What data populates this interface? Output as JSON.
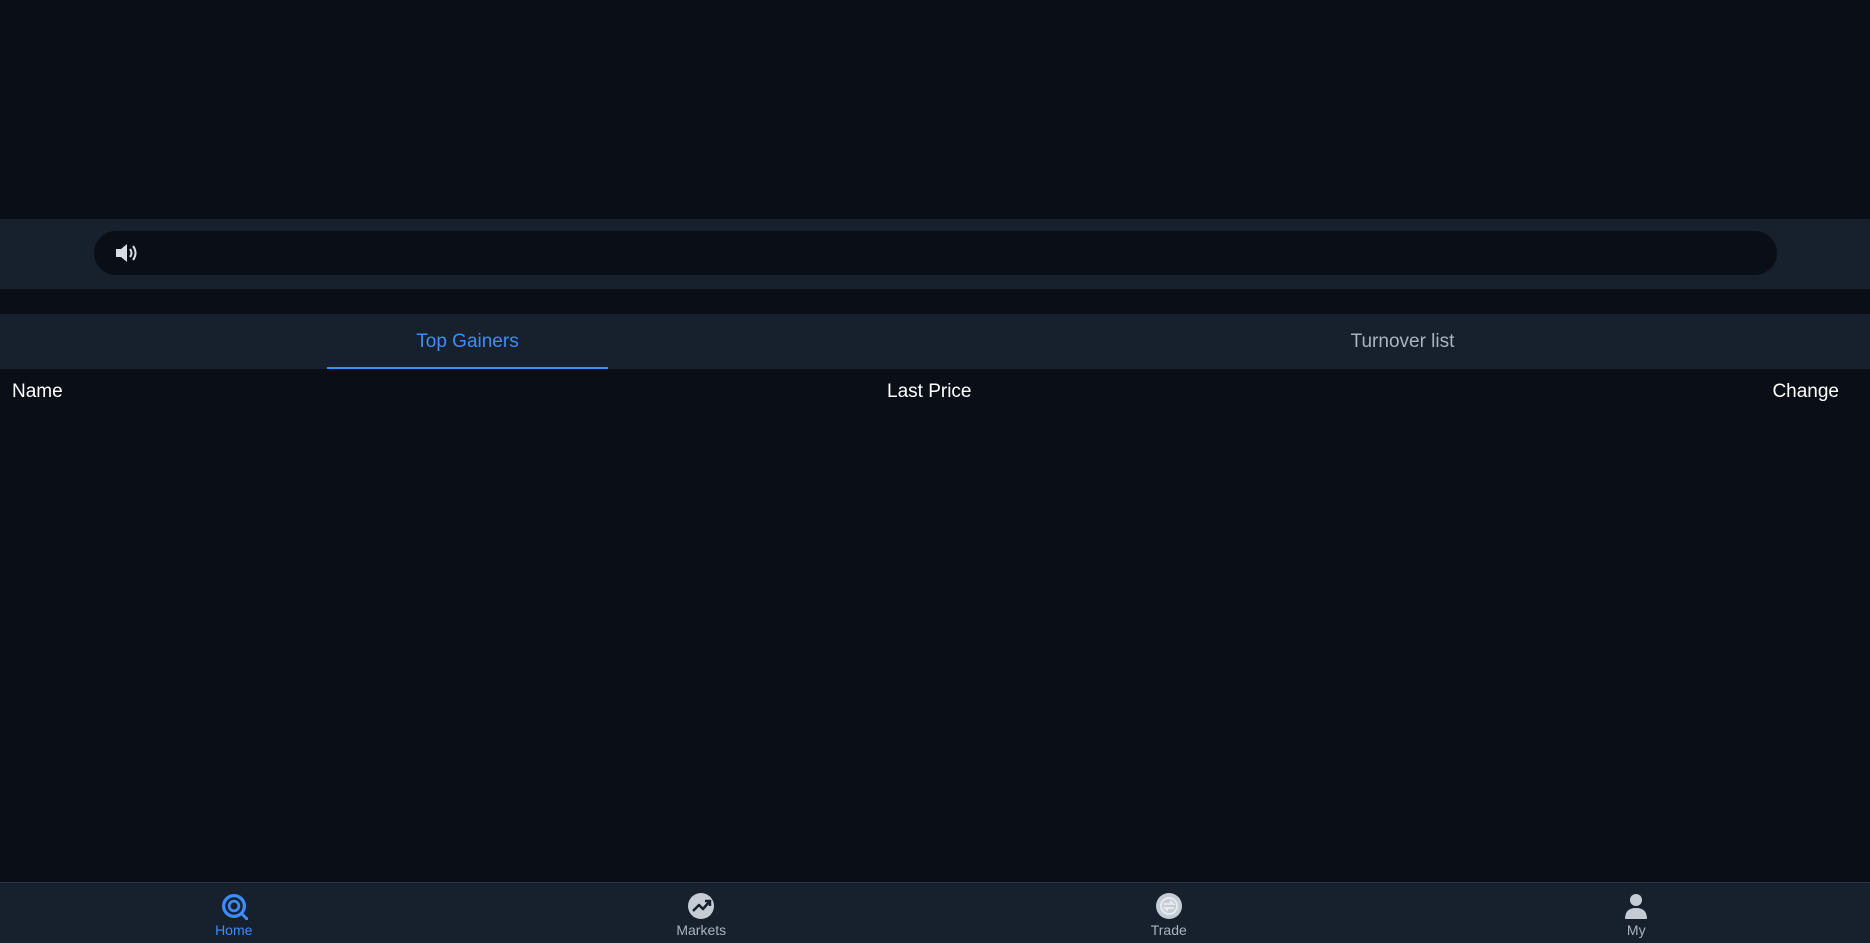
{
  "notice": {
    "icon": "speaker-icon",
    "text": ""
  },
  "tabs": [
    {
      "label": "Top Gainers",
      "active": true
    },
    {
      "label": "Turnover list",
      "active": false
    }
  ],
  "table": {
    "columns": {
      "name": "Name",
      "last_price": "Last Price",
      "change": "Change"
    },
    "rows": []
  },
  "bottom_nav": [
    {
      "label": "Home",
      "icon": "home-icon",
      "active": true
    },
    {
      "label": "Markets",
      "icon": "markets-icon",
      "active": false
    },
    {
      "label": "Trade",
      "icon": "trade-icon",
      "active": false
    },
    {
      "label": "My",
      "icon": "user-icon",
      "active": false
    }
  ],
  "colors": {
    "background": "#0a0e17",
    "panel": "#16212d",
    "accent": "#3d8bfd",
    "muted_text": "#a9b3bf"
  }
}
